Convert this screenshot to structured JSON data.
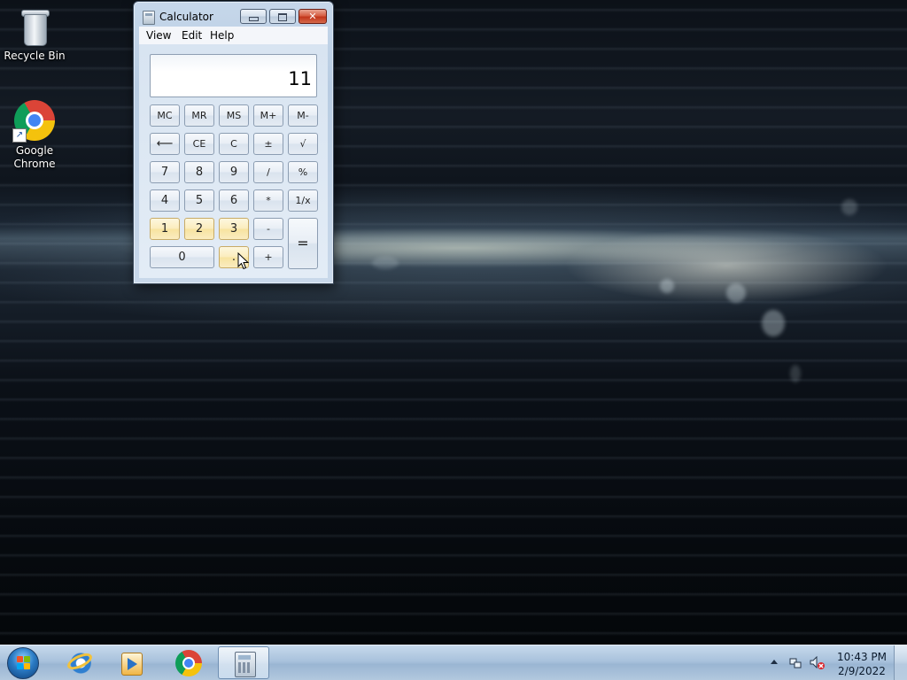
{
  "desktop": {
    "icons": [
      {
        "label": "Recycle Bin",
        "icon": "recycle-bin-icon"
      },
      {
        "label": "Google Chrome",
        "icon": "chrome-icon"
      }
    ]
  },
  "calculator": {
    "title": "Calculator",
    "menu": [
      "View",
      "Edit",
      "Help"
    ],
    "display": "11",
    "keys": {
      "mc": "MC",
      "mr": "MR",
      "ms": "MS",
      "mplus": "M+",
      "mminus": "M-",
      "backspace": "⟵",
      "ce": "CE",
      "c": "C",
      "plusminus": "±",
      "sqrt": "√",
      "k7": "7",
      "k8": "8",
      "k9": "9",
      "divide": "/",
      "percent": "%",
      "k4": "4",
      "k5": "5",
      "k6": "6",
      "multiply": "*",
      "reciprocal": "1/x",
      "k1": "1",
      "k2": "2",
      "k3": "3",
      "minus": "-",
      "equals": "=",
      "k0": "0",
      "decimal": ".",
      "plus": "+"
    },
    "highlighted_keys": [
      "1",
      "2",
      "3"
    ]
  },
  "taskbar": {
    "pinned": [
      "internet-explorer-icon",
      "windows-media-player-icon",
      "chrome-icon",
      "calculator-icon"
    ],
    "active": "calculator-icon",
    "clock_time": "10:43 PM",
    "clock_date": "2/9/2022"
  }
}
